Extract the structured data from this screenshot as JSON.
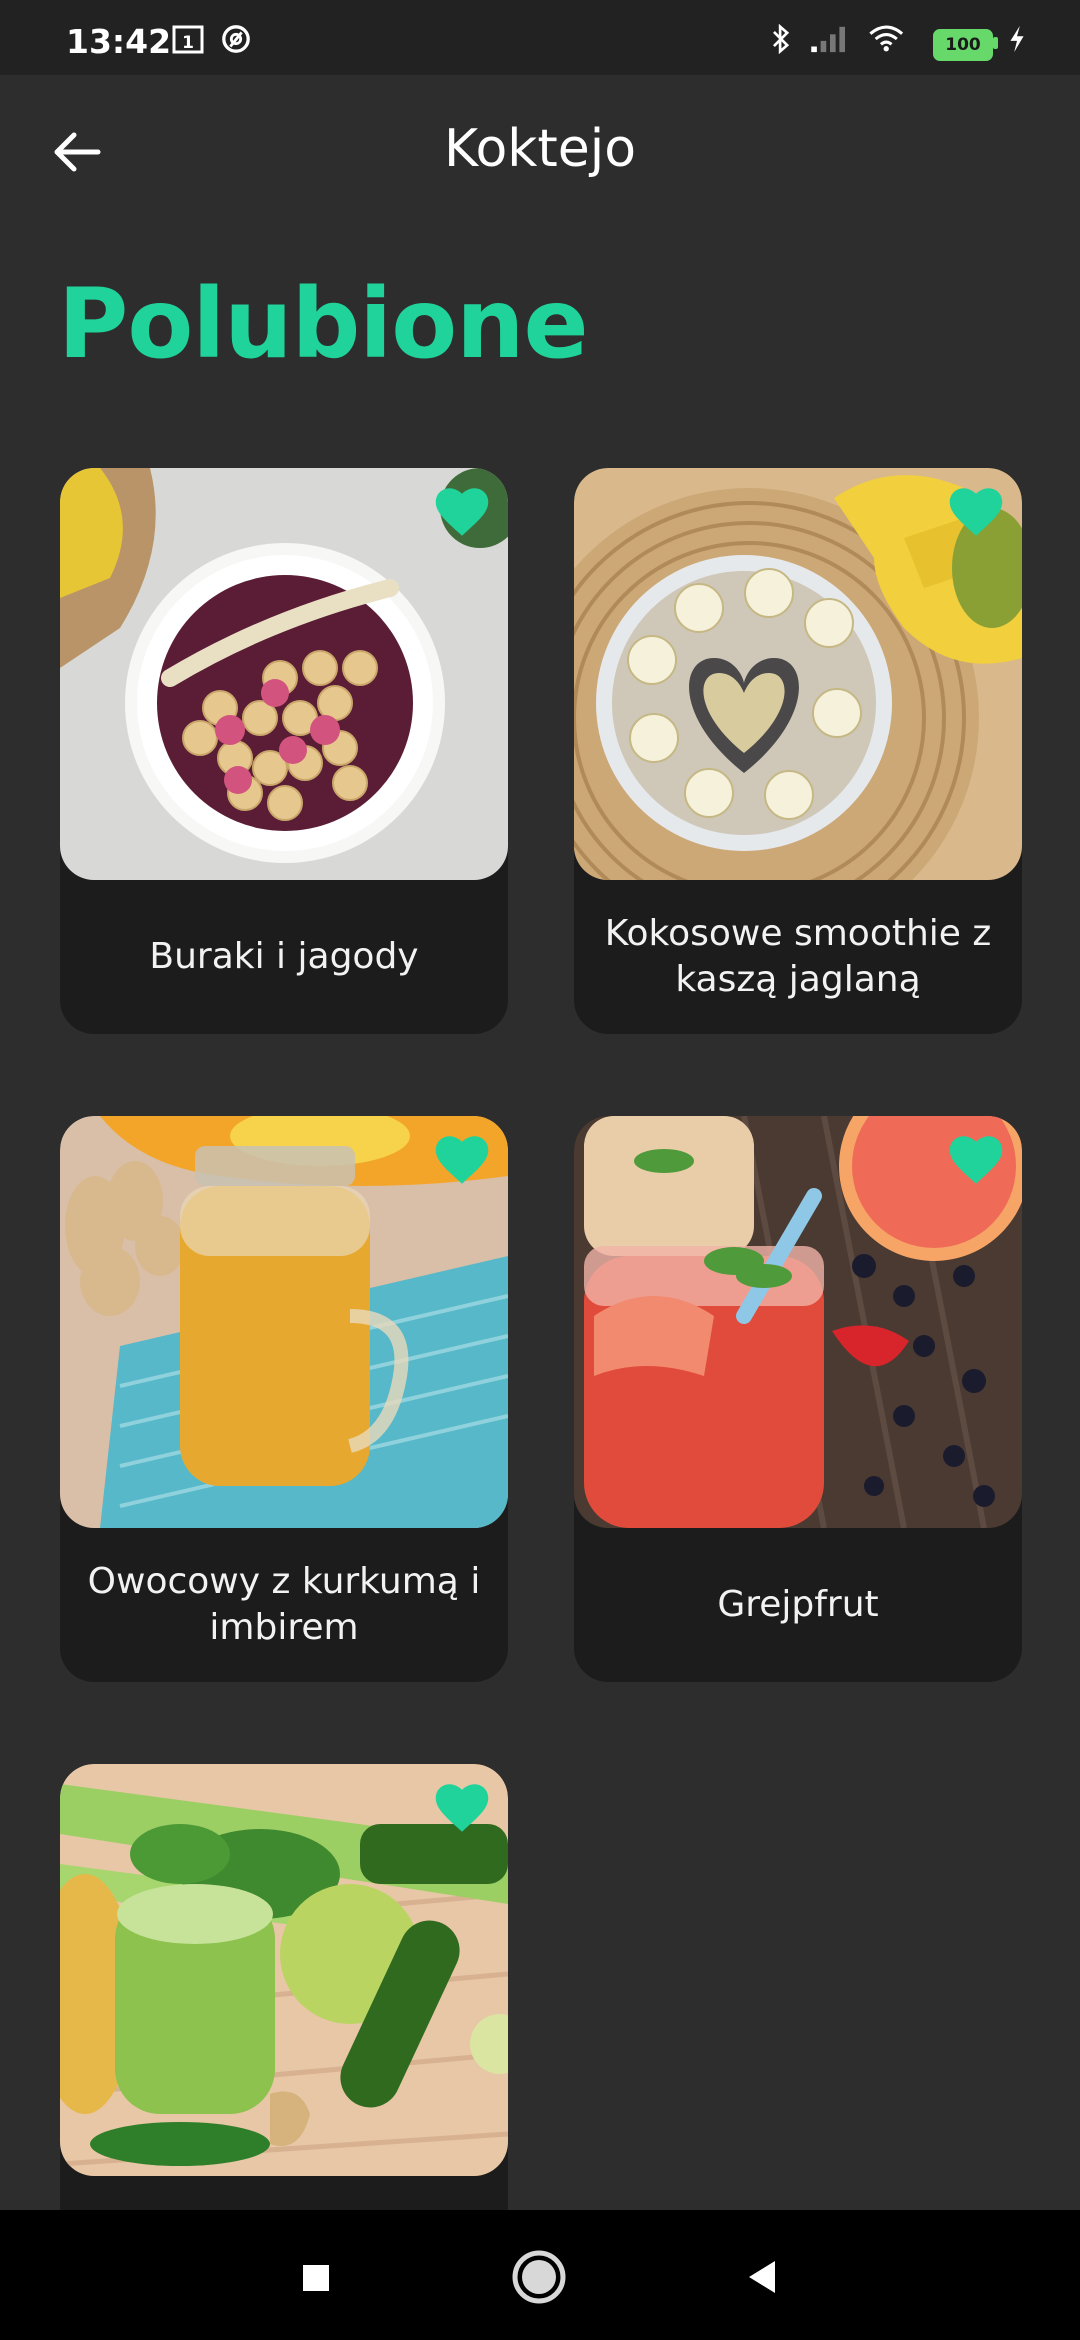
{
  "status_bar": {
    "time": "13:42",
    "battery": "100",
    "icons": [
      "calendar-icon",
      "at-icon",
      "bluetooth-icon",
      "signal-icon",
      "wifi-icon",
      "battery-icon",
      "charging-icon"
    ]
  },
  "app_bar": {
    "title": "Koktejo",
    "back_icon": "arrow-left-icon"
  },
  "section": {
    "title": "Polubione"
  },
  "favorites": [
    {
      "name": "Buraki i jagody",
      "favorited": true,
      "image": "beet-berry-smoothie-bowl"
    },
    {
      "name": "Kokosowe smoothie z kaszą jaglaną",
      "favorited": true,
      "image": "coconut-millet-smoothie-bowl"
    },
    {
      "name": "Owocowy z kurkumą i imbirem",
      "favorited": true,
      "image": "turmeric-ginger-smoothie-jar"
    },
    {
      "name": "Grejpfrut",
      "favorited": true,
      "image": "grapefruit-smoothie-jar"
    },
    {
      "name": "",
      "favorited": true,
      "image": "green-smoothie-vegetables"
    }
  ],
  "colors": {
    "accent": "#1fd39a",
    "background": "#2d2d2d",
    "card": "#1c1c1c",
    "status_bar": "#222222",
    "nav_bar": "#000000"
  },
  "nav_bar": {
    "buttons": [
      "recents-square-icon",
      "home-circle-icon",
      "back-triangle-icon"
    ]
  }
}
